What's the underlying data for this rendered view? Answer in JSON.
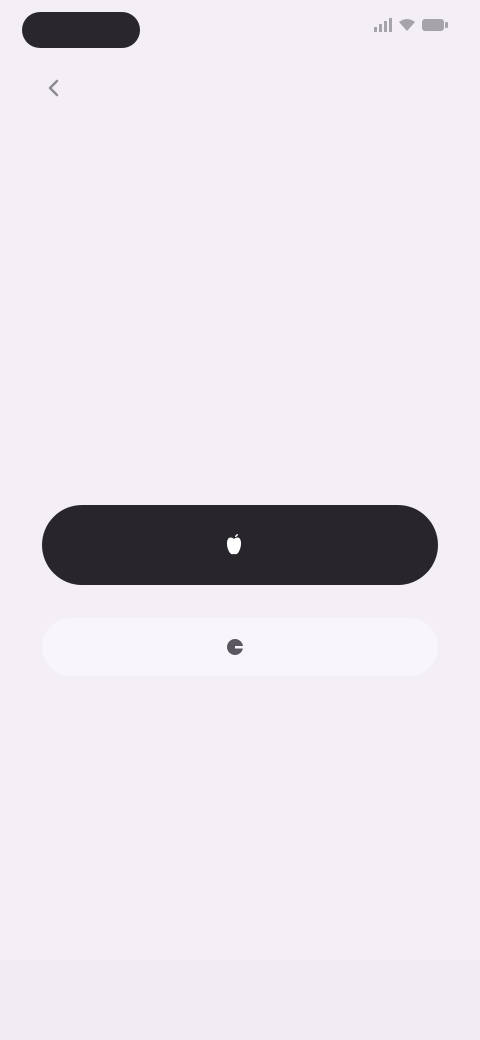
{
  "status_bar": {
    "time": "",
    "icons": [
      "signal-icon",
      "wifi-icon",
      "battery-icon"
    ]
  },
  "top_bar": {
    "title": "",
    "back_icon": "back-arrow-icon"
  },
  "main": {
    "heading": "",
    "subtitle": ""
  },
  "actions": {
    "primary_label": "",
    "primary_icon": "apple-icon",
    "secondary_label": "",
    "secondary_icon": "google-icon",
    "divider_text": "",
    "link_label": ""
  },
  "colors": {
    "background": "#f3eff5",
    "primary_button": "#28252b",
    "accent": "#8d9bc4"
  }
}
